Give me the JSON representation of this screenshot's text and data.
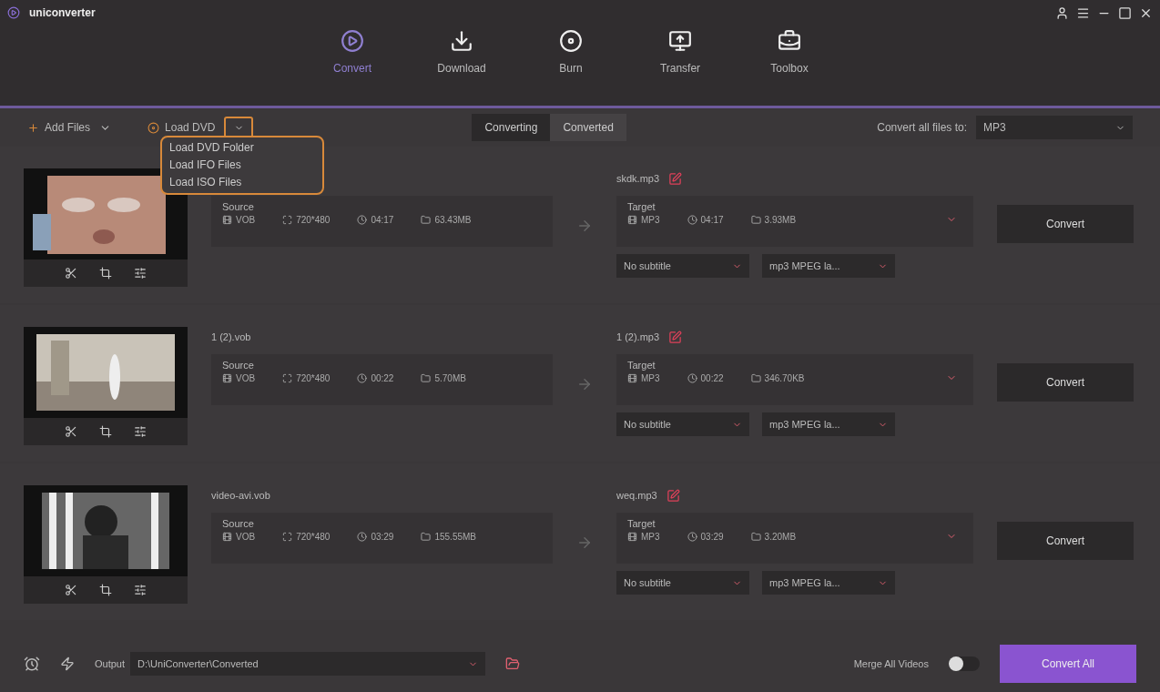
{
  "window": {
    "title": "uniconverter"
  },
  "nav": [
    {
      "label": "Convert",
      "selected": true
    },
    {
      "label": "Download",
      "selected": false
    },
    {
      "label": "Burn",
      "selected": false
    },
    {
      "label": "Transfer",
      "selected": false
    },
    {
      "label": "Toolbox",
      "selected": false
    }
  ],
  "toolbar": {
    "add_files": "Add Files",
    "load_dvd": "Load DVD",
    "load_menu": {
      "expanded": true,
      "items": [
        "Load DVD Folder",
        "Load IFO Files",
        "Load ISO Files"
      ]
    },
    "tabs": [
      {
        "label": "Converting",
        "selected": true
      },
      {
        "label": "Converted",
        "selected": false
      }
    ],
    "convert_all_label": "Convert all files to:",
    "convert_all_value": "MP3"
  },
  "files": [
    {
      "source_label": "Source",
      "format": "VOB",
      "resolution": "720*480",
      "duration": "04:17",
      "size": "63.43MB",
      "target_name": "skdk.mp3",
      "target_label": "Target",
      "target_format": "MP3",
      "target_duration": "04:17",
      "target_size": "3.93MB",
      "subtitle": "No subtitle",
      "audio": "mp3 MPEG la...",
      "button": "Convert"
    },
    {
      "source_name": "1 (2).vob",
      "source_label": "Source",
      "format": "VOB",
      "resolution": "720*480",
      "duration": "00:22",
      "size": "5.70MB",
      "target_name": "1 (2).mp3",
      "target_label": "Target",
      "target_format": "MP3",
      "target_duration": "00:22",
      "target_size": "346.70KB",
      "subtitle": "No subtitle",
      "audio": "mp3 MPEG la...",
      "button": "Convert"
    },
    {
      "source_name": "video-avi.vob",
      "source_label": "Source",
      "format": "VOB",
      "resolution": "720*480",
      "duration": "03:29",
      "size": "155.55MB",
      "target_name": "weq.mp3",
      "target_label": "Target",
      "target_format": "MP3",
      "target_duration": "03:29",
      "target_size": "3.20MB",
      "subtitle": "No subtitle",
      "audio": "mp3 MPEG la...",
      "button": "Convert"
    }
  ],
  "bottom": {
    "output_label": "Output",
    "output_path": "D:\\UniConverter\\Converted",
    "merge_label": "Merge All Videos",
    "merge_on": false,
    "convert_all": "Convert All"
  }
}
